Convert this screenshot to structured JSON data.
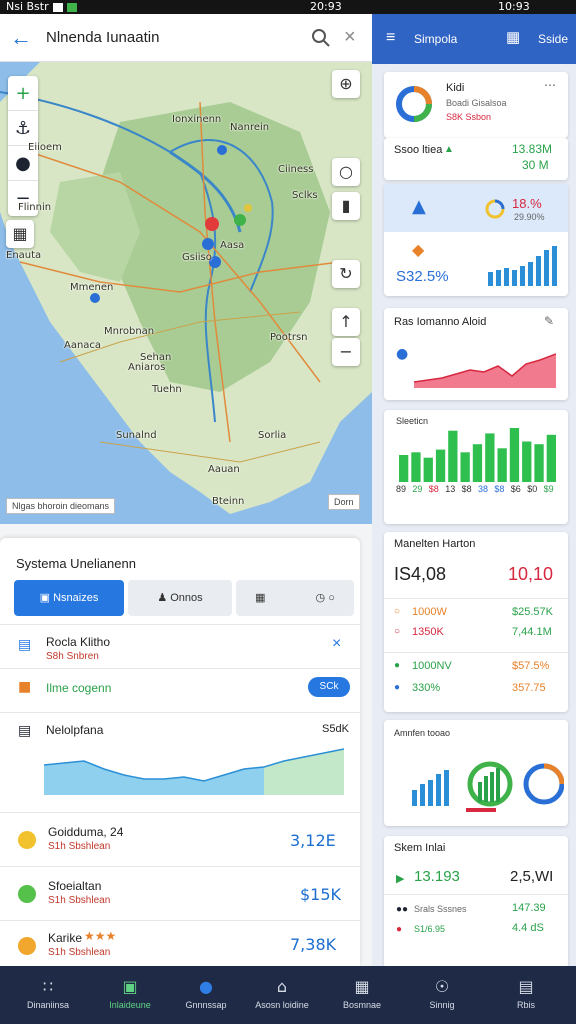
{
  "status_bar": {
    "left": "Nsi Bstr",
    "mid": "20:93",
    "right": "10:93"
  },
  "search": {
    "query": "Nlnenda Iunaatin"
  },
  "map": {
    "labels": [
      "Ionxinenn",
      "Nanrein",
      "Eiioem",
      "Flinnin",
      "Ciiness",
      "Sclks",
      "Enauta",
      "Aasa",
      "Gsiiso",
      "Pootrsn",
      "Sehan",
      "Aanaca",
      "Aniaros",
      "Sunalnd",
      "Sorlia",
      "Aauan",
      "Tuehn",
      "Mmenen",
      "Mnrobnan",
      "Bteinn"
    ],
    "coords": "Nlgas bhoroin dieomans",
    "scale": "Dorn"
  },
  "sheet": {
    "title": "Systema Unelianenn",
    "tabs": [
      "Nsnaizes",
      "Onnos",
      ""
    ],
    "route": {
      "title": "Rocla Klitho",
      "sub": "S8h Snbren"
    },
    "promo": {
      "label": "Ilme cogenn",
      "pill": "SCk"
    },
    "chart": {
      "title": "Nelolpfana",
      "value": "S5dK"
    },
    "items": [
      {
        "title": "Goidduma, 24",
        "sub": "S1h Sbshlean",
        "value": "3,12E"
      },
      {
        "title": "Sfoeialtan",
        "sub": "S1h Sbshlean",
        "value": "$15K"
      },
      {
        "title": "Karike",
        "sub": "S1h Sbshlean",
        "value": "7,38K"
      }
    ]
  },
  "right": {
    "header": {
      "title": "Simpola",
      "action": "Sside"
    },
    "kpi": {
      "title": "Kidi",
      "line1": "Boadi Gisalsoa",
      "line2": "S8K Ssbon"
    },
    "stats": {
      "label": "Ssoo ltiea",
      "v1": "13.83M",
      "v2": "30 M"
    },
    "rate": {
      "pct": "18.%",
      "sub": "29.90%",
      "big": "S32.5%"
    },
    "trend": {
      "title": "Ras Iomanno Aloid"
    },
    "volume": {
      "title": "Sleeticn",
      "ticks": [
        "89",
        "29",
        "$8",
        "13",
        "$8",
        "38",
        "$8",
        "$6",
        "$0",
        "$9"
      ],
      "values": [
        20,
        22,
        18,
        24,
        38,
        22,
        28,
        36,
        25,
        40,
        30,
        28,
        35
      ]
    },
    "markets": {
      "title": "Manelten Harton",
      "left": "IS4,08",
      "right": "10,10",
      "rows": [
        {
          "a": "1000W",
          "b": "$25.57K",
          "ca": "orange",
          "cb": "green"
        },
        {
          "a": "1350K",
          "b": "7,44.1M",
          "ca": "red",
          "cb": "green"
        },
        {
          "a": "1000NV",
          "b": "$57.5%",
          "ca": "green",
          "cb": "orange"
        },
        {
          "a": "330%",
          "b": "357.75",
          "ca": "green",
          "cb": "orange"
        }
      ]
    },
    "growth": {
      "title": "Amnfen tooao"
    },
    "summary": {
      "title": "Skem Inlai",
      "v1": "13.193",
      "v2": "2,5,WI",
      "r1a": "Srals Sssnes",
      "r1b": "147.39",
      "r2a": "S1/6.95",
      "r2b": "4.4 dS"
    }
  },
  "nav": [
    {
      "icon": "grid",
      "label": "Dinaniinsa"
    },
    {
      "icon": "home",
      "label": "Inlaideune"
    },
    {
      "icon": "chat",
      "label": "Gnnnssap"
    },
    {
      "icon": "house",
      "label": "Asosn loidine"
    },
    {
      "icon": "chart",
      "label": "Bosmnae"
    },
    {
      "icon": "globe",
      "label": "Sinnig"
    },
    {
      "icon": "doc",
      "label": "Rbis"
    }
  ],
  "colors": {
    "accent": "#2677e0",
    "header": "#2f63c4",
    "nav": "#1f2b46",
    "green": "#2aa24a",
    "red": "#d6283f"
  }
}
